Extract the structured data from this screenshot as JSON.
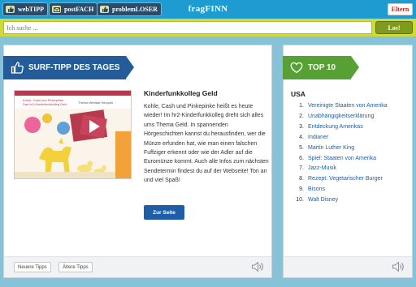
{
  "topbar": {
    "buttons": [
      {
        "label": "webTIPP",
        "icon": "thumbs-up-icon"
      },
      {
        "label": "postFACH",
        "icon": "envelope-icon"
      },
      {
        "label": "problemLOSER",
        "icon": "thumbs-up-icon"
      }
    ],
    "brand": "fragFINN",
    "eltern": "Eltern"
  },
  "search": {
    "placeholder": "Ich suche ...",
    "submit": "Los!"
  },
  "surf_tipp": {
    "ribbon": "SURF-TIPP DES TAGES",
    "thumbnail": {
      "logo_line1": "Kohle, Cash und Pinkepinke",
      "logo_line2": "Das hr2-Kinderfunkkolleg Geld",
      "nav": "Thema   Wettbal   Hörspiel"
    },
    "title": "Kinderfunkkolleg Geld",
    "body": "Kohle, Cash und Pinkepinke heißt es heute wieder! Im hr2-Kinderfunkkolleg dreht sich alles ums Thema Geld. In spannenden Hörgeschichten kannst du herausfinden, wer die Münze erfunden hat, wie man einen falschen Fuffziger erkennt oder wie der Adler auf die Euromünze kommt. Auch alle Infos zum nächsten Sendetermin findest du auf der Webseite! Ton an und viel Spaß!",
    "button": "Zur Seite",
    "footer": {
      "newer": "Neuere Tipps",
      "older": "Ältere Tipps"
    }
  },
  "top10": {
    "ribbon": "TOP 10",
    "heading": "USA",
    "items": [
      {
        "num": "1.",
        "label": "Vereinigte Staaten von Amerika"
      },
      {
        "num": "2.",
        "label": "Unabhängigkeitserklärung"
      },
      {
        "num": "3.",
        "label": "Entdeckung Amerikas"
      },
      {
        "num": "4.",
        "label": "Indianer"
      },
      {
        "num": "5.",
        "label": "Martin Luther King"
      },
      {
        "num": "6.",
        "label": "Spiel: Staaten von Amerika"
      },
      {
        "num": "7.",
        "label": "Jazz-Musik"
      },
      {
        "num": "8.",
        "label": "Rezept: Vegetarischer Burger"
      },
      {
        "num": "9.",
        "label": "Bisons"
      },
      {
        "num": "10.",
        "label": "Walt Disney"
      }
    ]
  }
}
